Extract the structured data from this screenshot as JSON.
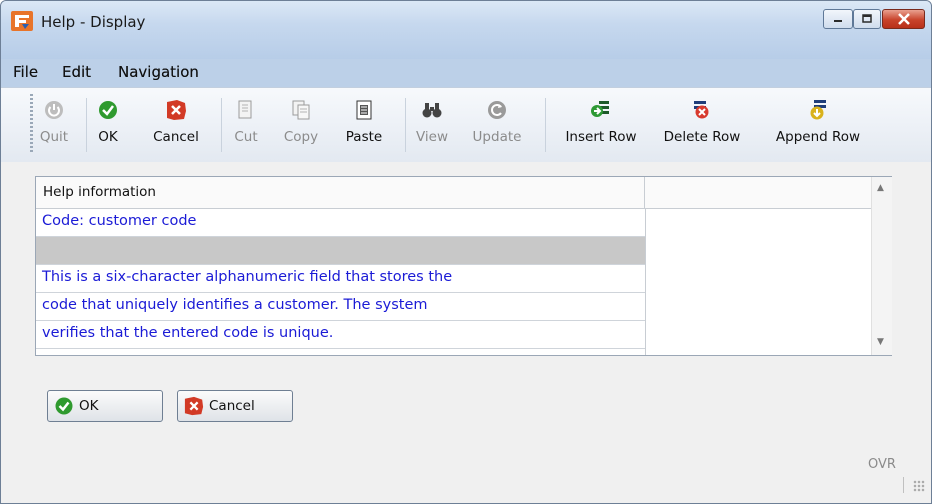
{
  "window": {
    "title": "Help - Display",
    "controls": [
      "minimize-icon",
      "maximize-icon",
      "close-icon"
    ]
  },
  "menu": [
    "File",
    "Edit",
    "Navigation"
  ],
  "toolbar": {
    "quit": "Quit",
    "ok": "OK",
    "cancel": "Cancel",
    "cut": "Cut",
    "copy": "Copy",
    "paste": "Paste",
    "view": "View",
    "update": "Update",
    "insert_row": "Insert Row",
    "delete_row": "Delete Row",
    "append_row": "Append Row"
  },
  "grid": {
    "header": "Help information",
    "rows": [
      "Code:   customer code",
      "",
      "This is a six-character alphanumeric field that stores the",
      "code that uniquely identifies a customer.  The system",
      "verifies that the entered code is unique."
    ]
  },
  "buttons": {
    "ok": "OK",
    "cancel": "Cancel"
  },
  "status": {
    "mode": "OVR"
  },
  "colors": {
    "title_bar": "#c6d8ee",
    "grid_text": "#1b1bd6",
    "selected_row": "#c8c8c8",
    "close_button": "#c8432b"
  }
}
